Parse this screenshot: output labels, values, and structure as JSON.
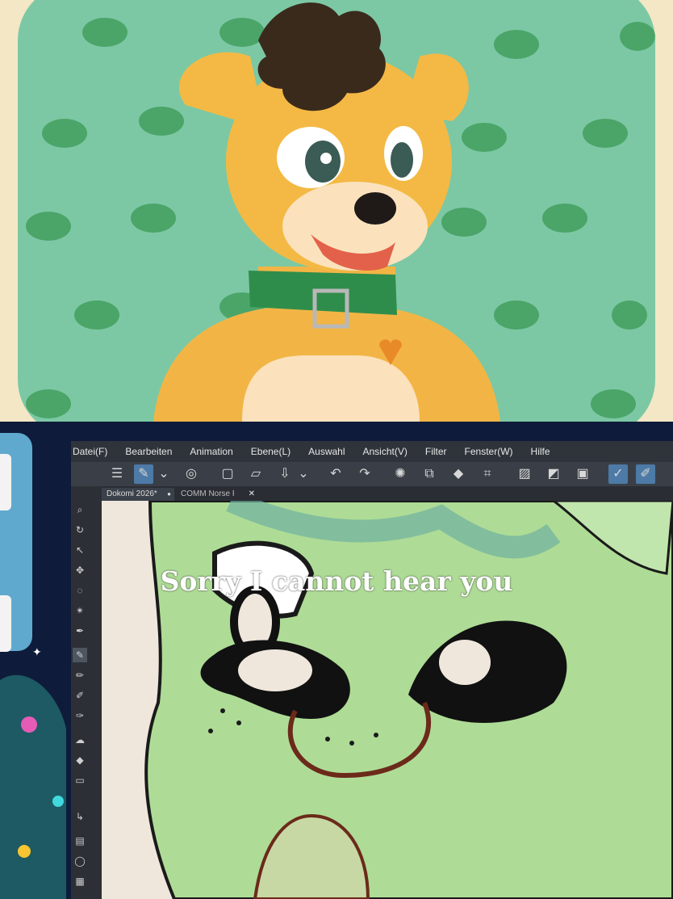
{
  "app": {
    "menu": [
      "Datei(F)",
      "Bearbeiten",
      "Animation",
      "Ebene(L)",
      "Auswahl",
      "Ansicht(V)",
      "Filter",
      "Fenster(W)",
      "Hilfe"
    ],
    "tabs": [
      {
        "label": "Dokomi 2026*",
        "modified_marker": "●"
      },
      {
        "label": "COMM Norse F",
        "close": "✕"
      }
    ]
  },
  "caption": "Sorry I cannot hear you",
  "colors": {
    "top_background": "#7cc8a4",
    "dog_fur": "#f2b545",
    "collar": "#2f8d4b",
    "canvas_fur": "#aedc96",
    "menubar": "#2f343b",
    "accent": "#4d7aa6"
  },
  "icons": {
    "toolbar": [
      "menu-icon",
      "brush-select-icon",
      "chevron-down-icon",
      "layer-icon",
      "new-file-icon",
      "folder-open-icon",
      "save-icon",
      "chevron-down-icon",
      "undo-icon",
      "redo-icon",
      "loading-icon",
      "transform-icon",
      "fill-icon",
      "crop-icon",
      "square-icon",
      "contrast-icon",
      "frame-icon",
      "pen-tool-icon",
      "brush-tool-icon"
    ]
  }
}
